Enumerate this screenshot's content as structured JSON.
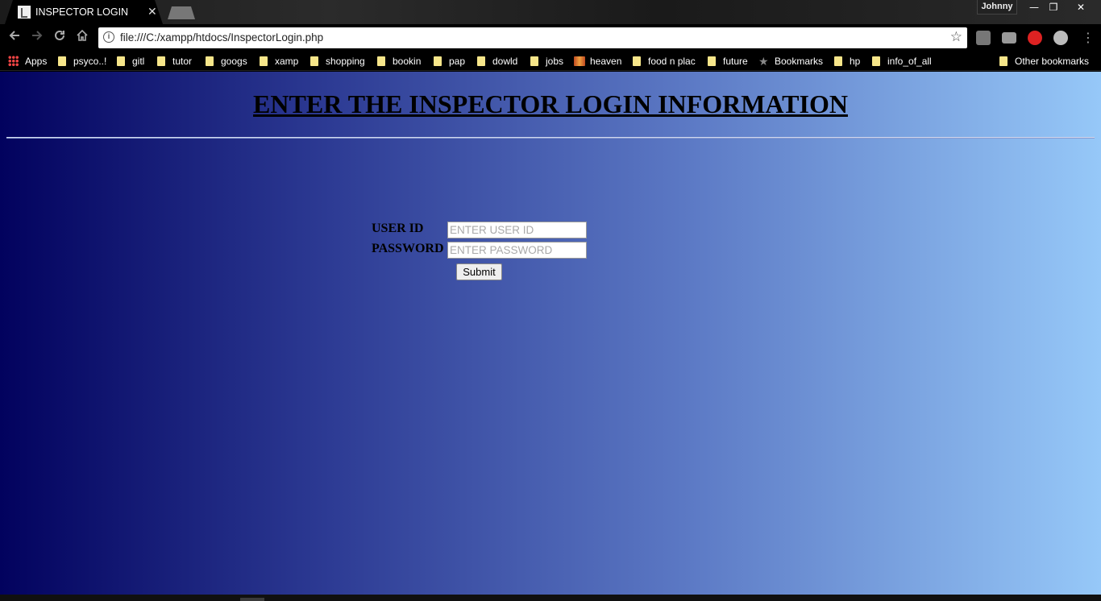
{
  "browser": {
    "tab_title": "INSPECTOR LOGIN",
    "tab_close": "✕",
    "profile_name": "Johnny",
    "window_controls": {
      "minimize": "—",
      "maximize": "❐",
      "close": "✕"
    },
    "url": "file:///C:/xampp/htdocs/InspectorLogin.php",
    "icons": {
      "back": "arrow-left-icon",
      "forward": "arrow-right-icon",
      "reload": "reload-icon",
      "home": "home-icon",
      "info": "info-icon",
      "star": "star-icon",
      "menu": "more-vert-icon"
    },
    "bookmarks": [
      {
        "label": "Apps",
        "icon": "apps-grid-icon"
      },
      {
        "label": "psyco..!",
        "icon": "folder-icon"
      },
      {
        "label": "gitl",
        "icon": "folder-icon"
      },
      {
        "label": "tutor",
        "icon": "folder-icon"
      },
      {
        "label": "googs",
        "icon": "folder-icon"
      },
      {
        "label": "xamp",
        "icon": "folder-icon"
      },
      {
        "label": "shopping",
        "icon": "folder-icon"
      },
      {
        "label": "bookin",
        "icon": "folder-icon"
      },
      {
        "label": "pap",
        "icon": "folder-icon"
      },
      {
        "label": "dowld",
        "icon": "folder-icon"
      },
      {
        "label": "jobs",
        "icon": "folder-icon"
      },
      {
        "label": "heaven",
        "icon": "heaven-favicon-icon"
      },
      {
        "label": "food n plac",
        "icon": "folder-icon"
      },
      {
        "label": "future",
        "icon": "folder-icon"
      },
      {
        "label": "Bookmarks",
        "icon": "star-icon"
      },
      {
        "label": "hp",
        "icon": "folder-icon"
      },
      {
        "label": "info_of_all",
        "icon": "folder-icon"
      }
    ],
    "other_bookmarks": "Other bookmarks"
  },
  "page": {
    "heading": "ENTER THE INSPECTOR LOGIN INFORMATION",
    "form": {
      "user_id_label": "USER ID",
      "user_id_placeholder": "ENTER USER ID",
      "user_id_value": "",
      "password_label": "PASSWORD",
      "password_placeholder": "ENTER PASSWORD",
      "password_value": "",
      "submit_label": "Submit"
    }
  }
}
